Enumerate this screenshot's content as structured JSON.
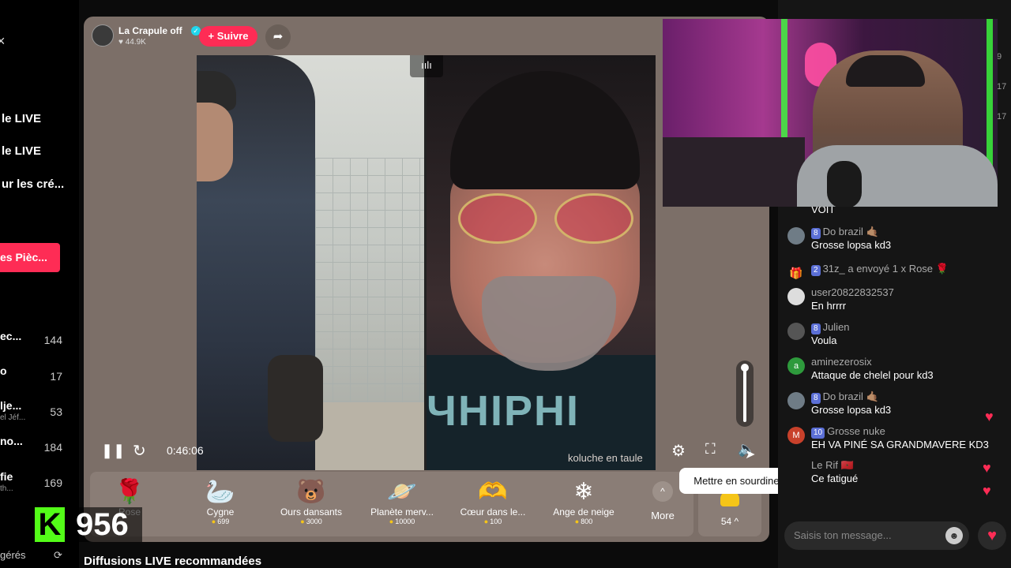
{
  "sidebar": {
    "close_icon": "×",
    "links": [
      "le LIVE",
      "le LIVE",
      "ur les cré..."
    ],
    "button_label": "es Pièc...",
    "live_rows": [
      {
        "name": "ec...",
        "sub": "",
        "count": "144"
      },
      {
        "name": "o",
        "sub": "",
        "count": "17"
      },
      {
        "name": "lje...",
        "sub": "el Jéf...",
        "count": "53"
      },
      {
        "name": "no...",
        "sub": "",
        "count": "184"
      },
      {
        "name": "fie",
        "sub": "th...",
        "count": "169"
      }
    ],
    "bottom_label": "gérés",
    "refresh_icon": "refresh-icon"
  },
  "player": {
    "host_name": "La Crapule off",
    "verified_icon": "✓",
    "likes": "♥ 44.9K",
    "follow_label": "+ Suivre",
    "share_icon": "➦",
    "sound_indicator": "ıılı",
    "guest_name": "koluche en taule",
    "shirt_text": "ЧНІРНІ",
    "time": "0:46:06",
    "tooltip": "Mettre en sourdine (M)",
    "volume_level": 1.0
  },
  "gifts": [
    {
      "name": "Rose",
      "price": "",
      "icon": "🌹"
    },
    {
      "name": "Cygne",
      "price": "699",
      "icon": "🦢"
    },
    {
      "name": "Ours dansants",
      "price": "3000",
      "icon": "🐻"
    },
    {
      "name": "Planète merv...",
      "price": "10000",
      "icon": "🪐"
    },
    {
      "name": "Cœur dans le...",
      "price": "100",
      "icon": "🫶"
    },
    {
      "name": "Ange de neige",
      "price": "800",
      "icon": "❄"
    }
  ],
  "more_label": "More",
  "coins_label": "54 ^",
  "recommended_label": "Diffusions LIVE recommandées",
  "kick_badge": {
    "letter": "K",
    "count": "956"
  },
  "chat": {
    "side_counts": [
      "9",
      "17",
      "17"
    ],
    "top_fragment": "VOIT",
    "messages": [
      {
        "user": "Do brazil 🤙🏽",
        "level": "8",
        "text": "Grosse lopsa kd3",
        "avatar": ""
      },
      {
        "user": "31z_ a envoyé 1 x Rose 🌹",
        "level": "2",
        "text": "",
        "avatar": "🎁"
      },
      {
        "user": "user20822832537",
        "level": "",
        "text": "En hrrrr",
        "avatar": ""
      },
      {
        "user": "Julien",
        "level": "8",
        "text": "Voula",
        "avatar": ""
      },
      {
        "user": "aminezerosix",
        "level": "",
        "text": "Attaque de chelel pour kd3",
        "avatar": "a"
      },
      {
        "user": "Do brazil 🤙🏽",
        "level": "8",
        "text": "Grosse lopsa kd3",
        "avatar": ""
      },
      {
        "user": "Grosse nuke",
        "level": "10",
        "text": "EH VA PINÉ SA GRANDMAVERE KD3",
        "avatar": "M"
      },
      {
        "user": "Le Rif 🇲🇦",
        "level": "",
        "text": "Ce fatigué",
        "avatar": ""
      }
    ],
    "input_placeholder": "Saisis ton message...",
    "emoji_icon": "☻",
    "like_icon": "♥"
  }
}
